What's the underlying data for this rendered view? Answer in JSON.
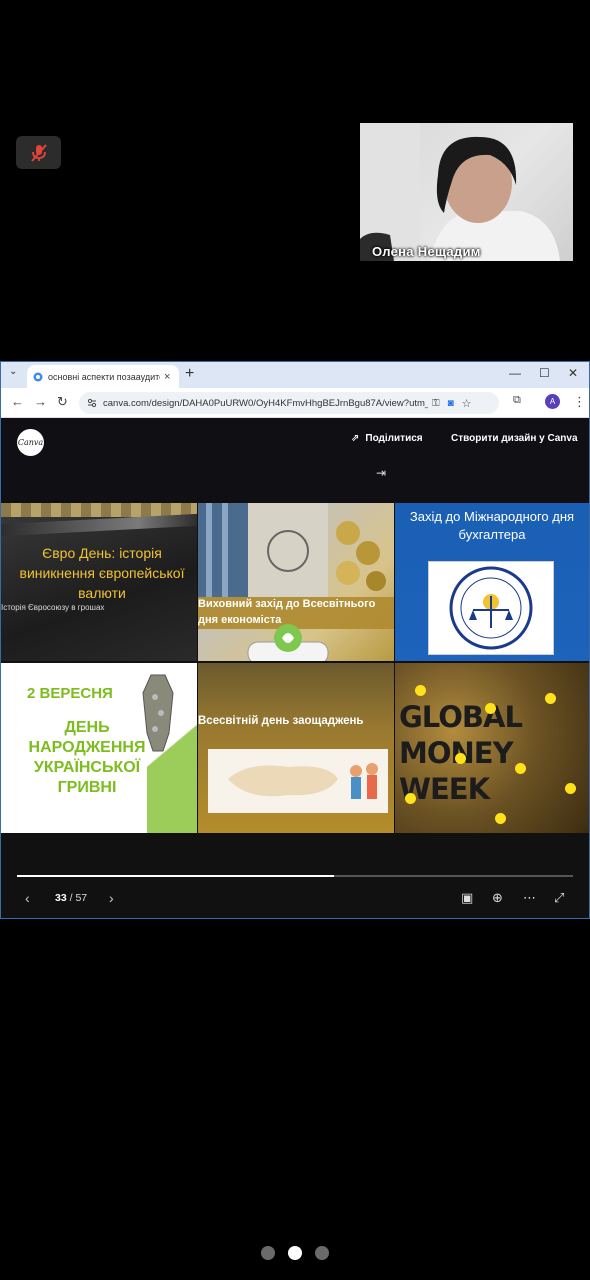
{
  "call": {
    "participant_name": "Олена Нещадим"
  },
  "browser": {
    "tab_title": "основні аспекти позааудитор…",
    "url": "canva.com/design/DAHA0PuURW0/OyH4KFmvHhgBEJrnBgu87A/view?utm_con…",
    "avatar_letter": "A"
  },
  "canva": {
    "logo_text": "Canva",
    "share_label": "Поділитися",
    "create_label": "Створити дизайн у Canva"
  },
  "slides": {
    "s1_title": "Євро День: історія виникнення європейської валюти",
    "s1_sub": "Історія Євросоюзу в грошах",
    "s2_title": "Виховний захід до Всесвітнього дня економіста",
    "s3_title": "Захід до Міжнародного дня бухгалтера",
    "s4_date": "2 ВЕРЕСНЯ",
    "s4_title": "ДЕНЬ НАРОДЖЕННЯ УКРАЇНСЬКОЇ ГРИВНІ",
    "s5_title": "Всесвітній день заощаджень",
    "s6_title": "GLOBAL MONEY WEEK"
  },
  "pager": {
    "current": "33",
    "total": "57",
    "progress_fraction": 0.57
  },
  "colors": {
    "accent_yellow": "#f1c232",
    "green": "#7dbd1e"
  }
}
